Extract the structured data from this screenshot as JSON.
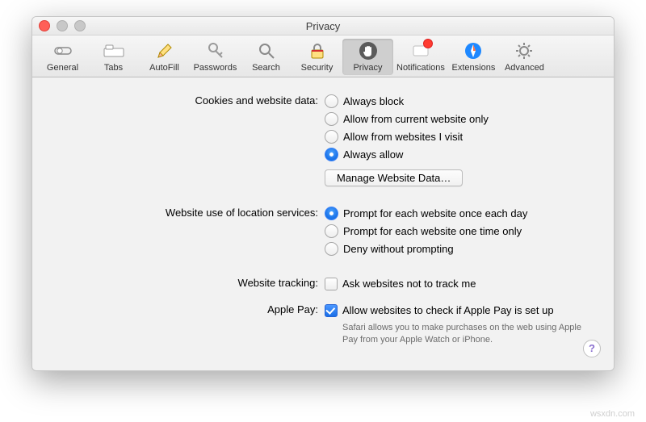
{
  "window": {
    "title": "Privacy"
  },
  "toolbar": {
    "items": [
      {
        "label": "General"
      },
      {
        "label": "Tabs"
      },
      {
        "label": "AutoFill"
      },
      {
        "label": "Passwords"
      },
      {
        "label": "Search"
      },
      {
        "label": "Security"
      },
      {
        "label": "Privacy"
      },
      {
        "label": "Notifications"
      },
      {
        "label": "Extensions"
      },
      {
        "label": "Advanced"
      }
    ]
  },
  "sections": {
    "cookies": {
      "label": "Cookies and website data:",
      "options": {
        "block": "Always block",
        "current": "Allow from current website only",
        "visited": "Allow from websites I visit",
        "always": "Always allow"
      },
      "manage_button": "Manage Website Data…"
    },
    "location": {
      "label": "Website use of location services:",
      "options": {
        "daily": "Prompt for each website once each day",
        "once": "Prompt for each website one time only",
        "deny": "Deny without prompting"
      }
    },
    "tracking": {
      "label": "Website tracking:",
      "checkbox": "Ask websites not to track me"
    },
    "applepay": {
      "label": "Apple Pay:",
      "checkbox": "Allow websites to check if Apple Pay is set up",
      "note": "Safari allows you to make purchases on the web using Apple Pay from your Apple Watch or iPhone."
    }
  },
  "help": "?",
  "watermark": "wsxdn.com"
}
